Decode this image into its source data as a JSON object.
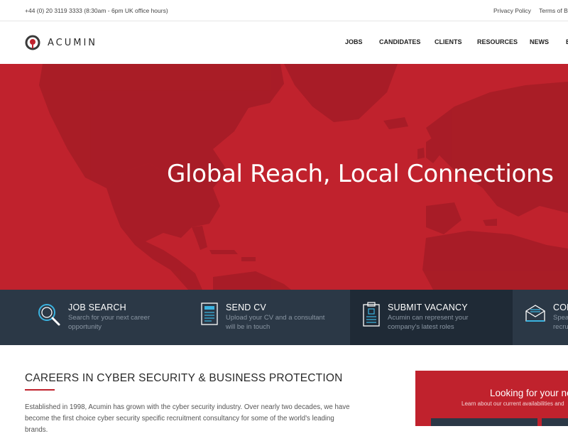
{
  "topbar": {
    "phone": "+44 (0) 20 3119 3333 (8:30am - 6pm UK office hours)",
    "links": [
      "Privacy Policy",
      "Terms of Busin"
    ]
  },
  "header": {
    "brand": "ACUMIN",
    "nav": [
      "JOBS",
      "CANDIDATES",
      "CLIENTS",
      "RESOURCES",
      "NEWS",
      "B"
    ]
  },
  "hero": {
    "title": "Global Reach, Local Connections",
    "background_color": "#c0222d"
  },
  "services": [
    {
      "icon": "magnifier-icon",
      "title": "JOB SEARCH",
      "desc1": "Search for your next career",
      "desc2": "opportunity"
    },
    {
      "icon": "document-icon",
      "title": "SEND CV",
      "desc1": "Upload your CV and a consultant",
      "desc2": "will be in touch"
    },
    {
      "icon": "clipboard-icon",
      "title": "SUBMIT VACANCY",
      "desc1": "Acumin can represent your",
      "desc2": "company's latest roles"
    },
    {
      "icon": "envelope-icon",
      "title": "CON",
      "desc1": "Spea",
      "desc2": "recru"
    }
  ],
  "careers": {
    "title": "CAREERS IN CYBER SECURITY & BUSINESS PROTECTION",
    "text": "Established in 1998, Acumin has grown with the cyber security industry. Over nearly two decades, we have become the first choice cyber security specific recruitment consultancy for some of the world's leading brands."
  },
  "looking": {
    "title": "Looking for your ne",
    "subtitle": "Learn about our current availabilities and"
  },
  "colors": {
    "accent": "#c0222d",
    "dark_navy": "#2b3846",
    "muted_text": "#8a96a3"
  }
}
